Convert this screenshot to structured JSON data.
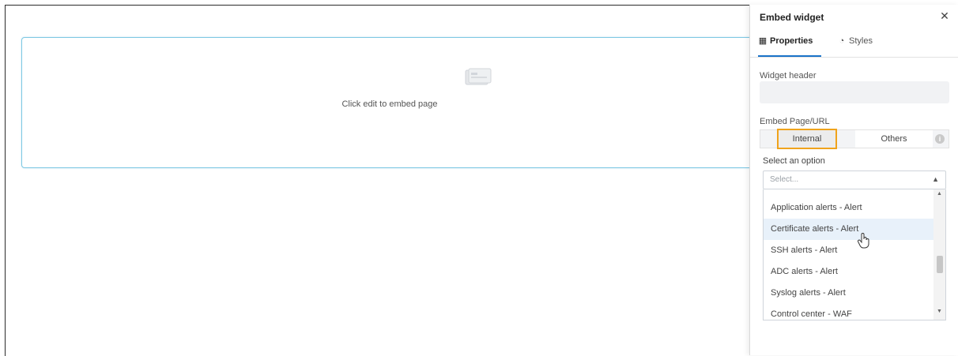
{
  "widget": {
    "hint": "Click edit to embed page",
    "icon": "embed-page-icon"
  },
  "panel": {
    "title": "Embed widget",
    "close_icon": "close-icon",
    "tabs": [
      {
        "label": "Properties",
        "icon": "grid-icon",
        "active": true
      },
      {
        "label": "Styles",
        "icon": "palette-icon",
        "active": false
      }
    ],
    "widget_header": {
      "label": "Widget header",
      "value": ""
    },
    "embed": {
      "label": "Embed Page/URL",
      "options": [
        "Internal",
        "Others"
      ],
      "selected": "Internal",
      "info_icon": "info-icon"
    },
    "select": {
      "label": "Select an option",
      "placeholder": "Select...",
      "items": [
        "Application alerts - Alert",
        "Certificate alerts - Alert",
        "SSH alerts - Alert",
        "ADC alerts - Alert",
        "Syslog alerts - Alert",
        "Control center - WAF"
      ],
      "hovered_item": "Certificate alerts - Alert"
    }
  },
  "colors": {
    "accent_highlight": "#f0a31b",
    "active_tab": "#1a73c8",
    "widget_border": "#7ec8e3",
    "hover_row": "#e8f1fa"
  }
}
